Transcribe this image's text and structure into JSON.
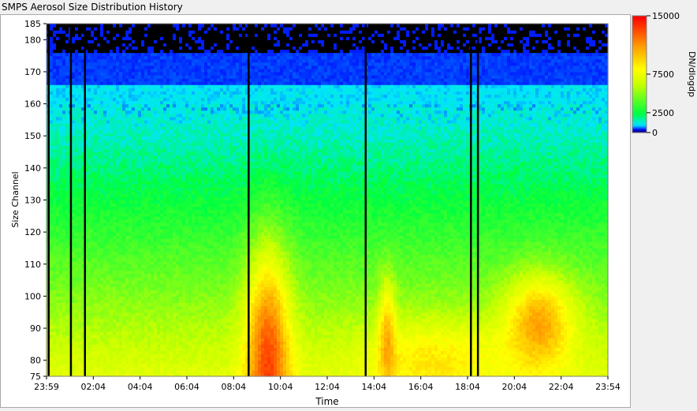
{
  "window": {
    "title": "SMPS Aerosol Size Distribution History"
  },
  "chart_data": {
    "type": "heatmap",
    "title": "",
    "xlabel": "Time",
    "ylabel": "Size Channel",
    "x_ticks": [
      "23:59",
      "02:04",
      "04:04",
      "06:04",
      "08:04",
      "10:04",
      "12:04",
      "14:04",
      "16:04",
      "18:04",
      "20:04",
      "22:04",
      "23:54"
    ],
    "y_ticks": [
      75,
      80,
      90,
      100,
      110,
      120,
      130,
      140,
      150,
      160,
      170,
      180,
      185
    ],
    "ylim": [
      75,
      185
    ],
    "colorbar": {
      "label": "DN/dlogdp",
      "ticks": [
        "15000",
        "7500",
        "2500",
        "0"
      ],
      "stops": [
        {
          "value": 0,
          "color": "#000000"
        },
        {
          "value": 0.03,
          "color": "#0000ff"
        },
        {
          "value": 0.07,
          "color": "#00e5ff"
        },
        {
          "value": 0.17,
          "color": "#00ff40"
        },
        {
          "value": 0.42,
          "color": "#c8ff00"
        },
        {
          "value": 0.55,
          "color": "#ffff00"
        },
        {
          "value": 0.75,
          "color": "#ff9a00"
        },
        {
          "value": 1.0,
          "color": "#ff0000"
        }
      ]
    },
    "missing_data_columns_hours": [
      0.05,
      1.0,
      1.6,
      8.6,
      13.6,
      18.1,
      18.4
    ],
    "pattern": "Concentration high at small channels (75-110), peaking near 09:00-10:00, 14:30 and 21:00; low counts (purple/black) above channel 165."
  }
}
